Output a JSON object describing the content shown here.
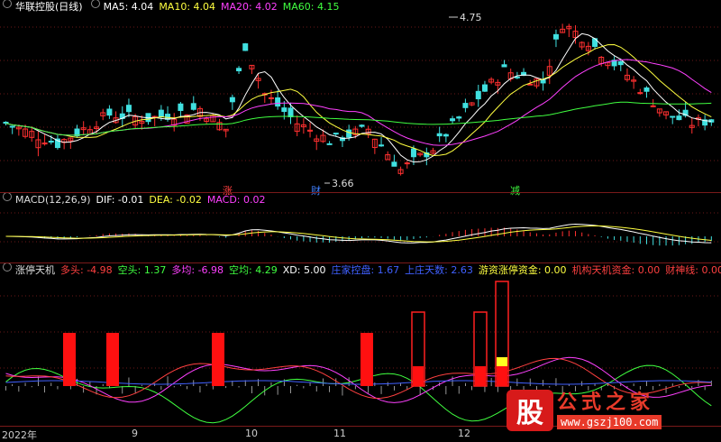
{
  "panel1": {
    "title": "华联控股(日线)",
    "ma": [
      {
        "label": "MA5: 4.04",
        "color": "#ffffff"
      },
      {
        "label": "MA10: 4.04",
        "color": "#ffff40"
      },
      {
        "label": "MA20: 4.02",
        "color": "#ff40ff"
      },
      {
        "label": "MA60: 4.15",
        "color": "#40ff40"
      }
    ],
    "high_label": "4.75",
    "low_label": "3.66",
    "events": [
      {
        "text": "涨",
        "color": "#ff4040"
      },
      {
        "text": "财",
        "color": "#4080ff"
      },
      {
        "text": "减",
        "color": "#40ff40"
      }
    ]
  },
  "panel2": {
    "title": "MACD(12,26,9)",
    "items": [
      {
        "label": "DIF: -0.01",
        "color": "#ffffff"
      },
      {
        "label": "DEA: -0.02",
        "color": "#ffff40"
      },
      {
        "label": "MACD: 0.02",
        "color": "#ff40ff"
      }
    ]
  },
  "panel3": {
    "title": "涨停天机",
    "items": [
      {
        "label": "多头: -4.98",
        "color": "#ff4040"
      },
      {
        "label": "空头: 1.37",
        "color": "#40ff40"
      },
      {
        "label": "多均: -6.98",
        "color": "#ff40ff"
      },
      {
        "label": "空均: 4.29",
        "color": "#40ff40"
      },
      {
        "label": "XD: 5.00",
        "color": "#ffffff"
      },
      {
        "label": "庄家控盘: 1.67",
        "color": "#4060ff"
      },
      {
        "label": "上庄天数: 2.63",
        "color": "#4060ff"
      },
      {
        "label": "游资涨停资金: 0.00",
        "color": "#ffff40"
      },
      {
        "label": "机构天机资金: 0.00",
        "color": "#ff4040"
      },
      {
        "label": "财神线: 0.00",
        "color": "#ff4040"
      }
    ]
  },
  "xaxis": {
    "labels": [
      "2022年",
      "9",
      "10",
      "11",
      "12"
    ]
  },
  "watermark": {
    "logo_char": "股",
    "title": "公式之家",
    "url": "www.gszj100.com"
  },
  "chart_data": {
    "type": "candlestick",
    "title": "华联控股(日线)",
    "price_high": 4.75,
    "price_low": 3.66,
    "ma_latest": {
      "MA5": 4.04,
      "MA10": 4.04,
      "MA20": 4.02,
      "MA60": 4.15
    },
    "macd_latest": {
      "DIF": -0.01,
      "DEA": -0.02,
      "MACD": 0.02
    },
    "tianji_latest": {
      "多头": -4.98,
      "空头": 1.37,
      "多均": -6.98,
      "空均": 4.29,
      "XD": 5.0,
      "庄家控盘": 1.67,
      "上庄天数": 2.63,
      "游资涨停资金": 0.0,
      "机构天机资金": 0.0,
      "财神线": 0.0
    },
    "x_labels": [
      "2022年",
      "9",
      "10",
      "11",
      "12"
    ],
    "red_signal_bars": 5,
    "outlined_signal_bars": 3
  }
}
